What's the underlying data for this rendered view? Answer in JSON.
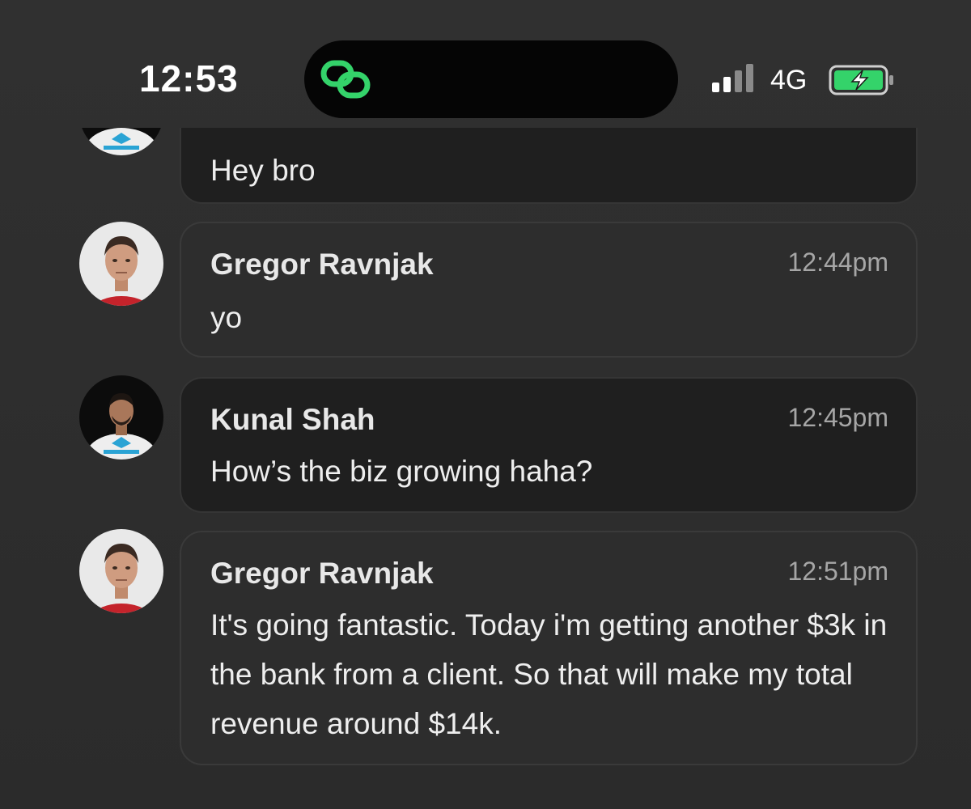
{
  "status_bar": {
    "time": "12:53",
    "network": "4G",
    "accent_color": "#34d36a",
    "island_icon": "link-chain-icon",
    "signal_icon": "cellular-signal-icon",
    "battery_icon": "battery-charging-icon"
  },
  "messages": [
    {
      "sender": "",
      "time": "",
      "text": "Hey bro",
      "avatar": "kunal-avatar",
      "style": "dark"
    },
    {
      "sender": "Gregor Ravnjak",
      "time": "12:44pm",
      "text": "yo",
      "avatar": "gregor-avatar",
      "style": "light"
    },
    {
      "sender": "Kunal Shah",
      "time": "12:45pm",
      "text": "How’s the biz growing haha?",
      "avatar": "kunal-avatar",
      "style": "dark"
    },
    {
      "sender": "Gregor Ravnjak",
      "time": "12:51pm",
      "text": "It's going fantastic. Today i'm getting another $3k in the bank from a client. So that will make my total revenue around $14k.",
      "avatar": "gregor-avatar",
      "style": "light"
    }
  ]
}
